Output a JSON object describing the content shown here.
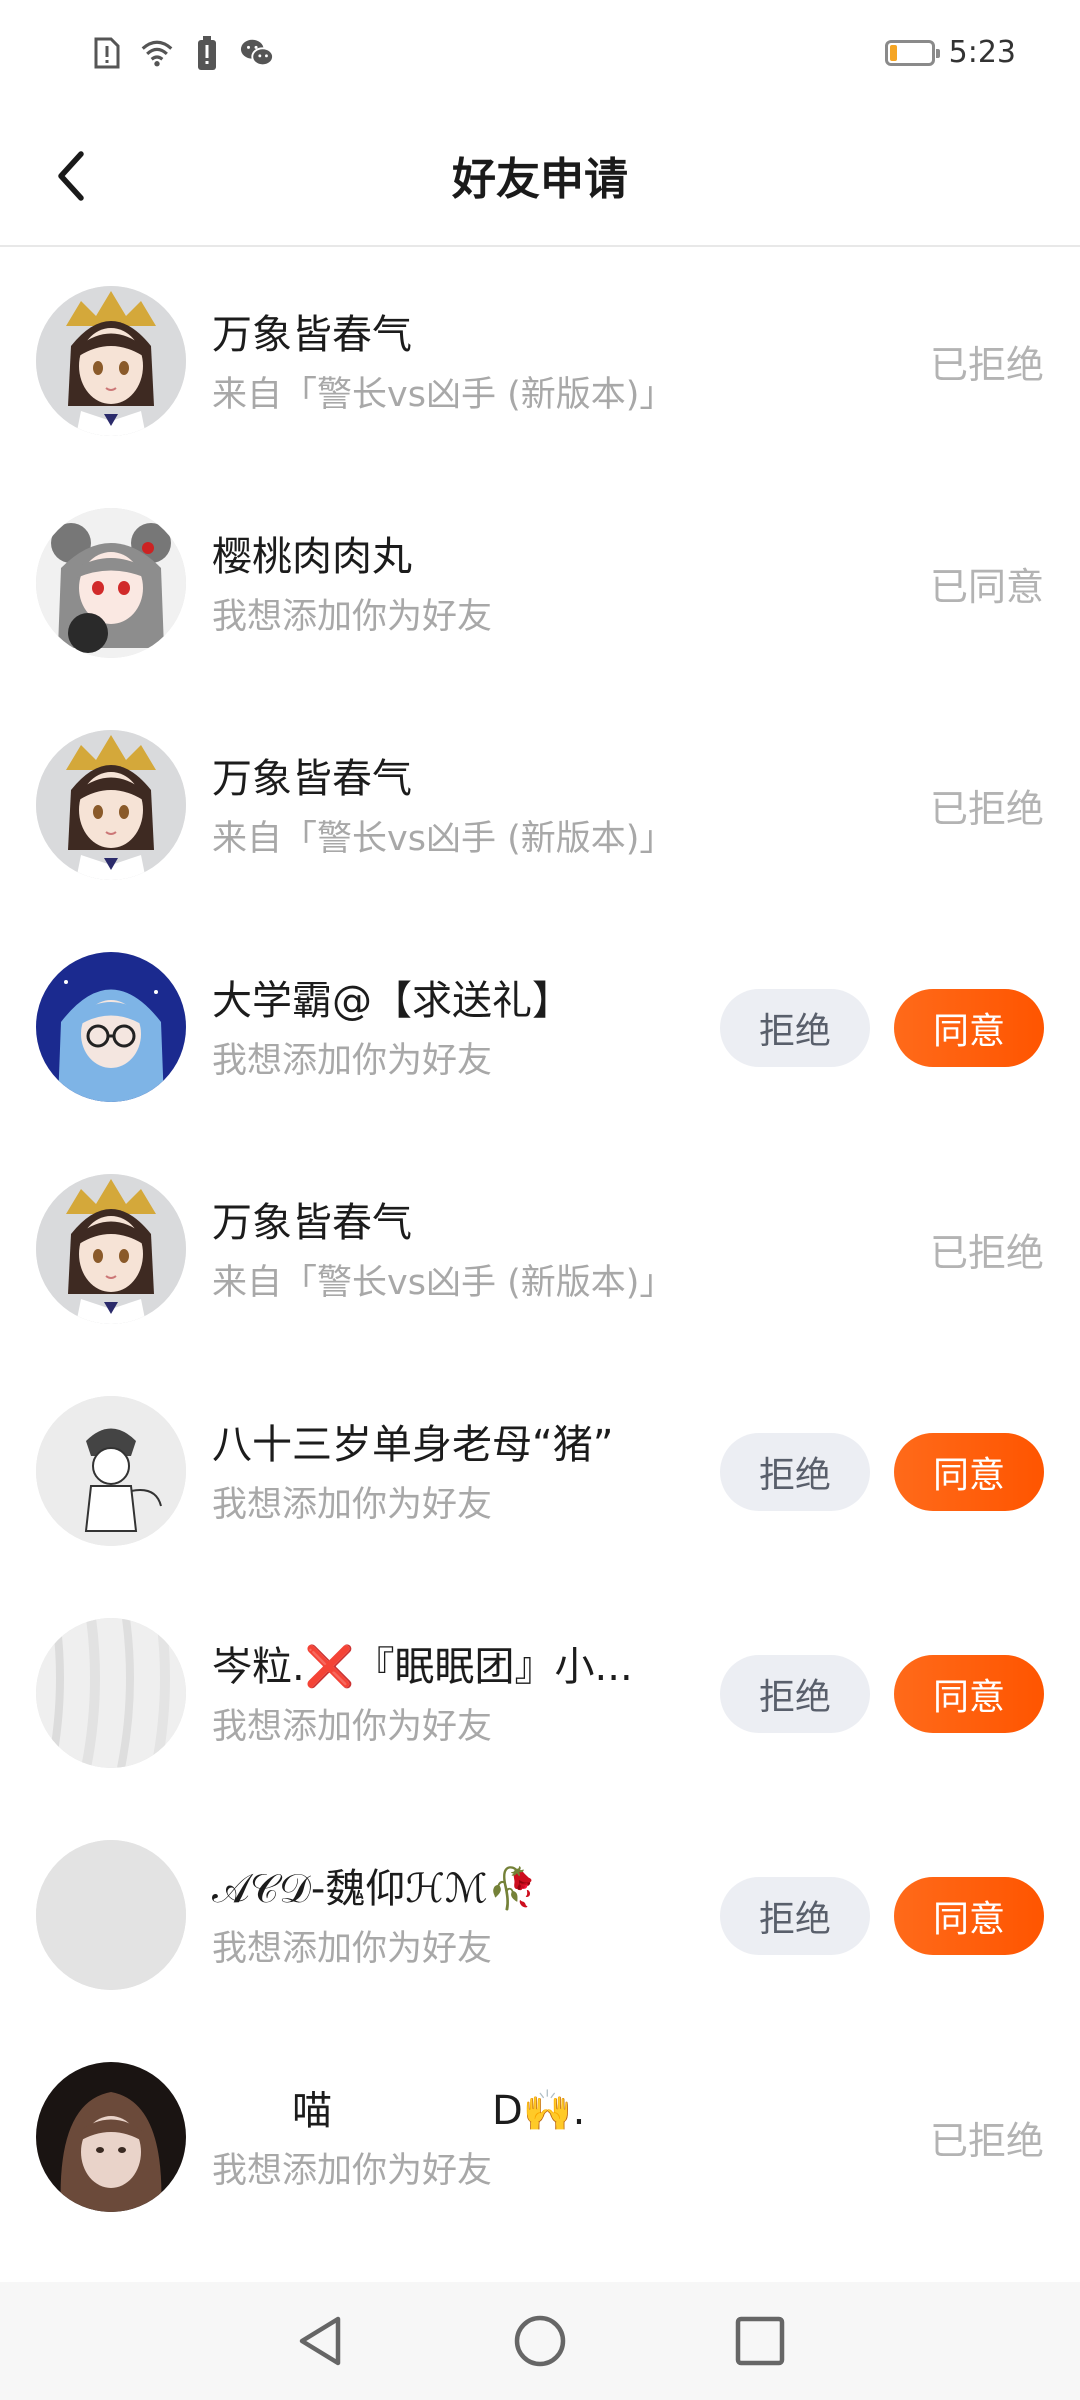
{
  "status_bar": {
    "time": "5:23",
    "icons": [
      "sim-alert-icon",
      "wifi-icon",
      "battery-alert-icon",
      "wechat-icon"
    ],
    "battery_level": 0.18,
    "battery_color": "#f5a524"
  },
  "header": {
    "title": "好友申请",
    "back_icon": "chevron-left-icon"
  },
  "requests": [
    {
      "name": "万象皆春气",
      "message": "来自「警长vs凶手 (新版本)」",
      "status": "已拒绝",
      "avatar": "anime-girl-gold-hairpiece"
    },
    {
      "name": "樱桃肉肉丸",
      "message": "我想添加你为好友",
      "status": "已同意",
      "avatar": "anime-girl-bear-ears"
    },
    {
      "name": "万象皆春气",
      "message": "来自「警长vs凶手 (新版本)」",
      "status": "已拒绝",
      "avatar": "anime-girl-gold-hairpiece"
    },
    {
      "name": "大学霸@【求送礼】",
      "message": "我想添加你为好友",
      "status": "",
      "reject_label": "拒绝",
      "accept_label": "同意",
      "avatar": "anime-blue-hair-glasses"
    },
    {
      "name": "万象皆春气",
      "message": "来自「警长vs凶手 (新版本)」",
      "status": "已拒绝",
      "avatar": "anime-girl-gold-hairpiece"
    },
    {
      "name": "八十三岁单身老母“猪”",
      "message": "我想添加你为好友",
      "status": "",
      "reject_label": "拒绝",
      "accept_label": "同意",
      "avatar": "sketch-character"
    },
    {
      "name": "岑粒.❌『眠眠团』小...",
      "message": "我想添加你为好友",
      "status": "",
      "reject_label": "拒绝",
      "accept_label": "同意",
      "avatar": "white-fabric"
    },
    {
      "name": "𝒜𝒞𝒟-魏仰ℋℳ🥀",
      "message": "我想添加你为好友",
      "status": "",
      "reject_label": "拒绝",
      "accept_label": "同意",
      "avatar": "blank-gray"
    },
    {
      "name": "　　喵　　　　D🙌.",
      "message": "我想添加你为好友",
      "status": "已拒绝",
      "avatar": "girl-brown-hair-photo"
    }
  ],
  "nav_bar": {
    "back": "triangle-back-icon",
    "home": "circle-home-icon",
    "recents": "square-recents-icon"
  },
  "colors": {
    "accent": "#ff5e14",
    "reject_bg": "#eceef3",
    "muted_text": "#a8a8a8"
  }
}
